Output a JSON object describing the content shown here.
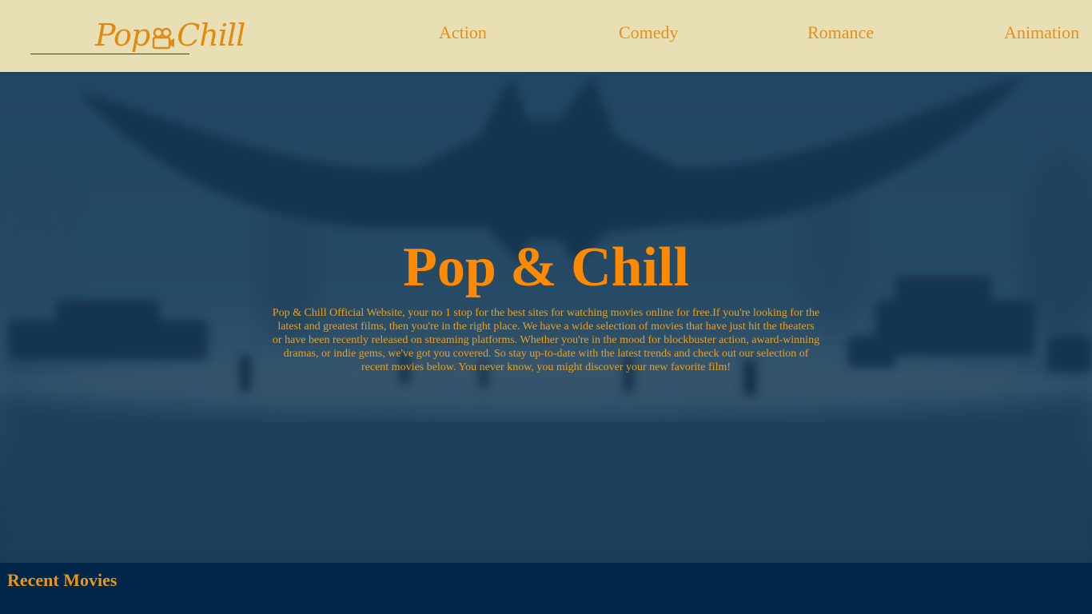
{
  "header": {
    "logo_left": "Pop",
    "logo_right": "Chill",
    "logo_icon": "movie-camera-icon",
    "nav": [
      {
        "label": "Action"
      },
      {
        "label": "Comedy"
      },
      {
        "label": "Romance"
      },
      {
        "label": "Animation"
      }
    ]
  },
  "hero": {
    "title": "Pop & Chill",
    "description": "Pop & Chill Official Website, your no 1 stop for the best sites for watching movies online for free.If you're looking for the latest and greatest films, then you're in the right place. We have a wide selection of movies that have just hit the theaters or have been recently released on streaming platforms. Whether you're in the mood for blockbuster action, award-winning dramas, or indie gems, we've got you covered. So stay up-to-date with the latest trends and check out our selection of recent movies below. You never know, you might discover your new favorite film!"
  },
  "recent": {
    "title": "Recent Movies"
  },
  "colors": {
    "header_bg": "#e8e0b4",
    "accent_orange": "#ff8a00",
    "nav_text": "#e0901c",
    "footer_bg": "#00264a"
  }
}
